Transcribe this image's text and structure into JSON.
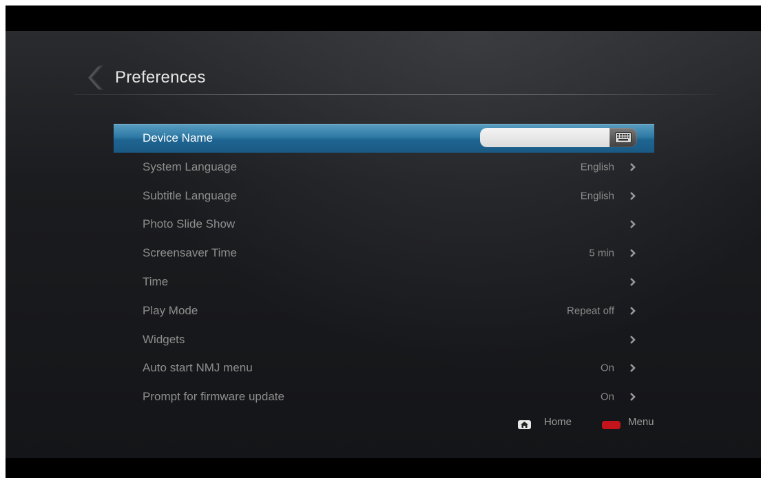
{
  "header": {
    "title": "Preferences",
    "back_icon": "chevron-left-icon"
  },
  "settings": [
    {
      "label": "Device Name",
      "value": "",
      "selected": true,
      "control": "text-input-with-keyboard"
    },
    {
      "label": "System Language",
      "value": "English"
    },
    {
      "label": "Subtitle Language",
      "value": "English"
    },
    {
      "label": "Photo Slide Show",
      "value": ""
    },
    {
      "label": "Screensaver Time",
      "value": "5 min"
    },
    {
      "label": "Time",
      "value": ""
    },
    {
      "label": "Play Mode",
      "value": "Repeat off"
    },
    {
      "label": "Widgets",
      "value": ""
    },
    {
      "label": "Auto start NMJ menu",
      "value": "On"
    },
    {
      "label": "Prompt for firmware update",
      "value": "On"
    }
  ],
  "device_name_input": {
    "value": "",
    "keyboard_icon": "keyboard-icon"
  },
  "footer": {
    "home_label": "Home",
    "menu_label": "Menu",
    "home_icon": "home-icon",
    "menu_color": "#c4141b"
  },
  "colors": {
    "selection": "#2f7aa6",
    "background": "#1b1c1f",
    "text_dim": "#8e8e8e"
  }
}
